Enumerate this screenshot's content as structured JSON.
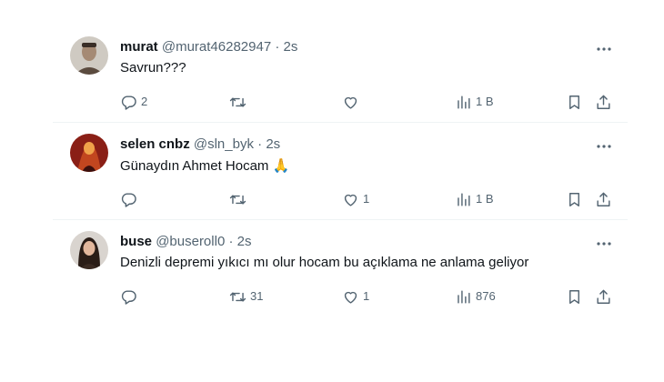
{
  "tweets": [
    {
      "name": "murat",
      "handle": "@murat46282947",
      "separator": "·",
      "time": "2s",
      "text": "Savrun???",
      "emoji": "",
      "replies": "2",
      "retweets": "",
      "likes": "",
      "views": "1 B",
      "avatar_bg": "#cfcac2",
      "avatar_fg": "#5b4b3f"
    },
    {
      "name": "selen cnbz",
      "handle": "@sln_byk",
      "separator": "·",
      "time": "2s",
      "text": "Günaydın Ahmet Hocam",
      "emoji": "🙏",
      "replies": "",
      "retweets": "",
      "likes": "1",
      "views": "1 B",
      "avatar_bg": "#8a1f16",
      "avatar_fg": "#f0a24a"
    },
    {
      "name": "buse",
      "handle": "@buseroll0",
      "separator": "·",
      "time": "2s",
      "text": "Denizli depremi yıkıcı mı olur hocam bu açıklama ne anlama geliyor",
      "emoji": "",
      "replies": "",
      "retweets": "31",
      "likes": "1",
      "views": "876",
      "avatar_bg": "#d9d4cf",
      "avatar_fg": "#3a2a22"
    }
  ],
  "colors": {
    "text_primary": "#0f1419",
    "text_secondary": "#536471",
    "divider": "#eff3f4"
  },
  "icons": [
    "more-icon",
    "reply-icon",
    "retweet-icon",
    "like-icon",
    "views-icon",
    "bookmark-icon",
    "share-icon"
  ]
}
